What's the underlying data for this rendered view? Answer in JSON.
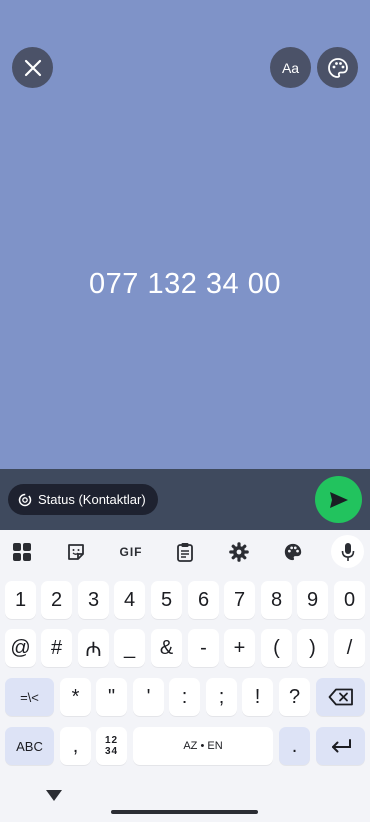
{
  "editor": {
    "status_text": "077 132 34 00",
    "font_label": "Aa",
    "background_color": "#7f93c8"
  },
  "composer": {
    "audience_label": "Status (Kontaktlar)"
  },
  "keyboard": {
    "toolbar": {
      "gif_label": "GIF"
    },
    "row1": [
      "1",
      "2",
      "3",
      "4",
      "5",
      "6",
      "7",
      "8",
      "9",
      "0"
    ],
    "row2": [
      "@",
      "#",
      "₼",
      "_",
      "&",
      "-",
      "+",
      "(",
      ")",
      "/"
    ],
    "row3": [
      "=\\<",
      "*",
      "\"",
      "'",
      ":",
      ";",
      "!",
      "?"
    ],
    "abc_label": "ABC",
    "comma_label": ",",
    "numpad_top": "12",
    "numpad_bottom": "34",
    "space_label": "AZ • EN",
    "period_label": "."
  }
}
